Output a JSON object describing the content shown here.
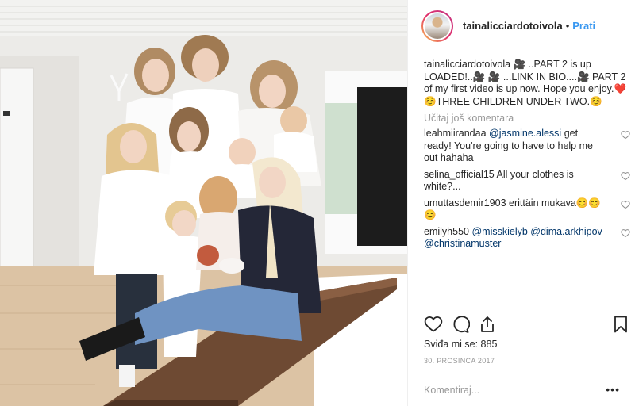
{
  "post": {
    "username": "tainalicciardotoivola",
    "separator": "•",
    "follow_label": "Prati",
    "caption": {
      "username": "tainalicciardotoivola",
      "text": "🎥 ..PART 2 is up LOADED!..🎥 🎥 ...LINK IN BIO....🎥 PART 2 of my first video is up now. Hope you enjoy.❤️ ☺️THREE CHILDREN UNDER TWO.☺️"
    },
    "load_more_label": "Učitaj još komentara",
    "comments": [
      {
        "username": "leahmiirandaa",
        "mention": "@jasmine.alessi",
        "text": " get ready! You're going to have to help me out hahaha"
      },
      {
        "username": "selina_official15",
        "mention": "",
        "text": "All your clothes is white?..."
      },
      {
        "username": "umuttasdemir1903",
        "mention": "",
        "text": "erittäin mukava😊😊😊"
      },
      {
        "username": "emilyh550",
        "mention": "@misskielyb @dima.arkhipov @christinamuster",
        "text": ""
      }
    ],
    "likes_text": "Sviđa mi se: 885",
    "date": "30. PROSINCA 2017",
    "comment_placeholder": "Komentiraj...",
    "more_label": "•••",
    "icons": {
      "like": "heart-icon",
      "comment": "comment-bubble-icon",
      "share": "share-upload-icon",
      "save": "bookmark-icon",
      "comment_like": "small-heart-icon"
    },
    "colors": {
      "link_blue": "#3897f0",
      "mention_blue": "#003569",
      "muted_gray": "#999999",
      "text": "#262626",
      "border": "#efefef"
    }
  }
}
